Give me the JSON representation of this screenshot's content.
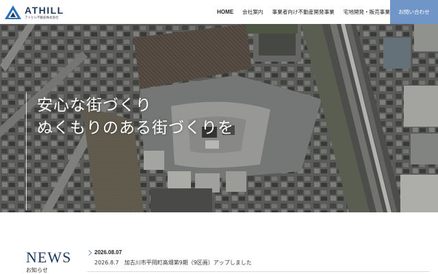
{
  "brand": {
    "name": "ATHILL",
    "tagline": "アトヒル不動産株式会社",
    "color": "#1f3a5c",
    "accent": "#6f96c7"
  },
  "nav": {
    "items": [
      {
        "label": "HOME"
      },
      {
        "label": "会社案内"
      },
      {
        "label": "事業者向け不動産開発事業"
      },
      {
        "label": "宅地開発・販売事業"
      }
    ],
    "contact_label": "お問い合わせ"
  },
  "hero": {
    "line1": "安心な街づくり",
    "line2": "ぬくもりのある街づくりを"
  },
  "news": {
    "title": "NEWS",
    "subtitle": "お知らせ",
    "items": [
      {
        "date": "2026.08.07",
        "text": "2026.8.7　加古川市平岡町高畑第9期（9区画）アップしました"
      }
    ]
  }
}
